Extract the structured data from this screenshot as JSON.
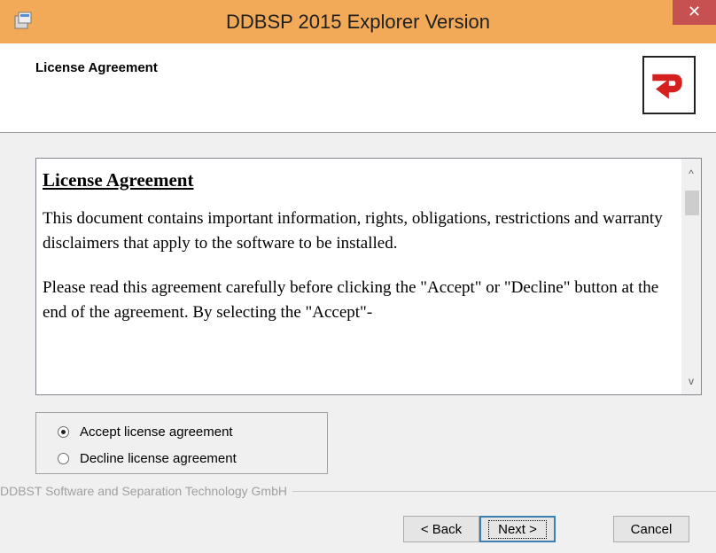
{
  "window": {
    "title": "DDBSP 2015 Explorer Version",
    "close_glyph": "✕"
  },
  "header": {
    "title": "License Agreement",
    "logo_icon": "ddbst-logo-icon"
  },
  "document": {
    "heading": "License Agreement",
    "paragraphs": [
      "This document contains important information, rights, obligations, restrictions and warranty disclaimers that apply to the software to be installed.",
      "Please read this agreement carefully before clicking the \"Accept\" or \"Decline\" button at the end of the agreement. By selecting the \"Accept\"-"
    ],
    "scroll_up_glyph": "^",
    "scroll_down_glyph": "v"
  },
  "options": {
    "accept_label": "Accept license agreement",
    "decline_label": "Decline license agreement",
    "selected": "accept"
  },
  "footer": {
    "company": "DDBST Software and Separation Technology GmbH"
  },
  "buttons": {
    "back": "< Back",
    "next": "Next >",
    "cancel": "Cancel"
  }
}
